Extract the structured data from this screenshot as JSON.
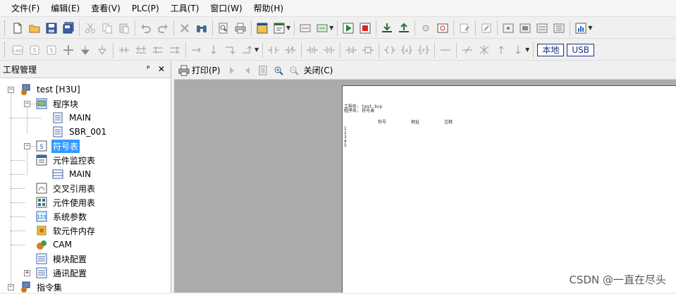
{
  "menu": [
    "文件(F)",
    "编辑(E)",
    "查看(V)",
    "PLC(P)",
    "工具(T)",
    "窗口(W)",
    "帮助(H)"
  ],
  "toolbar2": {
    "local_label": "本地",
    "usb_label": "USB"
  },
  "pane": {
    "title": "工程管理",
    "pin": "ᴾ",
    "close": "✕"
  },
  "tree": {
    "project": "test [H3U]",
    "program_block": "程序块",
    "main": "MAIN",
    "sbr": "SBR_001",
    "symbol_table": "符号表",
    "monitor_table": "元件监控表",
    "monitor_main": "MAIN",
    "cross_ref": "交叉引用表",
    "usage_table": "元件使用表",
    "sys_params": "系统参数",
    "soft_memory": "软元件内存",
    "cam": "CAM",
    "module_config": "模块配置",
    "comm_config": "通讯配置",
    "instruction_set": "指令集"
  },
  "preview": {
    "print_label": "打印(P)",
    "close_label": "关闭(C)",
    "page": {
      "project_line": "工程名: test.bcp",
      "program_line": "程序名: 符号表",
      "col_symbol": "符号",
      "col_address": "地址",
      "col_comment": "注释",
      "rows": [
        "1",
        "2",
        "3",
        "4",
        "5"
      ]
    }
  },
  "watermark": "CSDN @一直在尽头"
}
